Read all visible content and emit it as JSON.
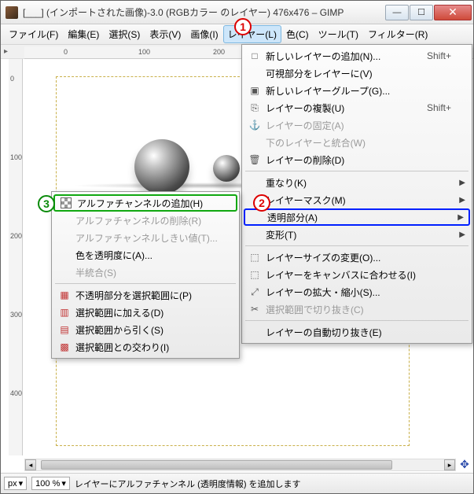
{
  "title": "[___] (インポートされた画像)-3.0 (RGBカラー     のレイヤー) 476x476 – GIMP",
  "menubar": [
    "ファイル(F)",
    "編集(E)",
    "選択(S)",
    "表示(V)",
    "画像(I)",
    "レイヤー(L)",
    "色(C)",
    "ツール(T)",
    "フィルター(R)"
  ],
  "menubar_open_index": 5,
  "ruler_h": {
    "50": "0",
    "145": "100",
    "240": "200"
  },
  "ruler_v": {
    "20": "0",
    "120": "100",
    "220": "200",
    "320": "300",
    "420": "400"
  },
  "layer_menu": [
    {
      "label": "新しいレイヤーの追加(N)...",
      "icon": "□",
      "shortcut": "Shift+",
      "arrow": false
    },
    {
      "label": "可視部分をレイヤーに(V)",
      "icon": "",
      "arrow": false
    },
    {
      "label": "新しいレイヤーグループ(G)...",
      "icon": "▣",
      "arrow": false
    },
    {
      "label": "レイヤーの複製(U)",
      "icon": "⎘",
      "shortcut": "Shift+",
      "arrow": false
    },
    {
      "label": "レイヤーの固定(A)",
      "icon": "⚓",
      "disabled": true,
      "arrow": false
    },
    {
      "label": "下のレイヤーと統合(W)",
      "icon": "",
      "disabled": true,
      "arrow": false
    },
    {
      "label": "レイヤーの削除(D)",
      "icon": "🗑",
      "arrow": false
    },
    {
      "sep": true
    },
    {
      "label": "重なり(K)",
      "arrow": true
    },
    {
      "label": "レイヤーマスク(M)",
      "arrow": true
    },
    {
      "label": "透明部分(A)",
      "arrow": true,
      "hl": "blue"
    },
    {
      "label": "変形(T)",
      "arrow": true
    },
    {
      "sep": true
    },
    {
      "label": "レイヤーサイズの変更(O)...",
      "icon": "⬚",
      "arrow": false
    },
    {
      "label": "レイヤーをキャンバスに合わせる(I)",
      "icon": "⬚",
      "arrow": false
    },
    {
      "label": "レイヤーの拡大・縮小(S)...",
      "icon": "⤢",
      "arrow": false
    },
    {
      "label": "選択範囲で切り抜き(C)",
      "icon": "✂",
      "disabled": true,
      "arrow": false
    },
    {
      "sep": true
    },
    {
      "label": "レイヤーの自動切り抜き(E)",
      "arrow": false
    }
  ],
  "submenu": [
    {
      "label": "アルファチャンネルの追加(H)",
      "icon": "alpha",
      "hl": "green"
    },
    {
      "label": "アルファチャンネルの削除(R)",
      "disabled": true
    },
    {
      "label": "アルファチャンネルしきい値(T)...",
      "disabled": true
    },
    {
      "label": "色を透明度に(A)..."
    },
    {
      "label": "半統合(S)",
      "disabled": true
    },
    {
      "sep": true
    },
    {
      "label": "不透明部分を選択範囲に(P)",
      "icon": "red"
    },
    {
      "label": "選択範囲に加える(D)",
      "icon": "red2"
    },
    {
      "label": "選択範囲から引く(S)",
      "icon": "red3"
    },
    {
      "label": "選択範囲との交わり(I)",
      "icon": "red4"
    }
  ],
  "status": {
    "unit": "px",
    "zoom": "100 %",
    "msg": "レイヤーにアルファチャンネル (透明度情報) を追加します"
  },
  "badges": {
    "1": "1",
    "2": "2",
    "3": "3"
  }
}
